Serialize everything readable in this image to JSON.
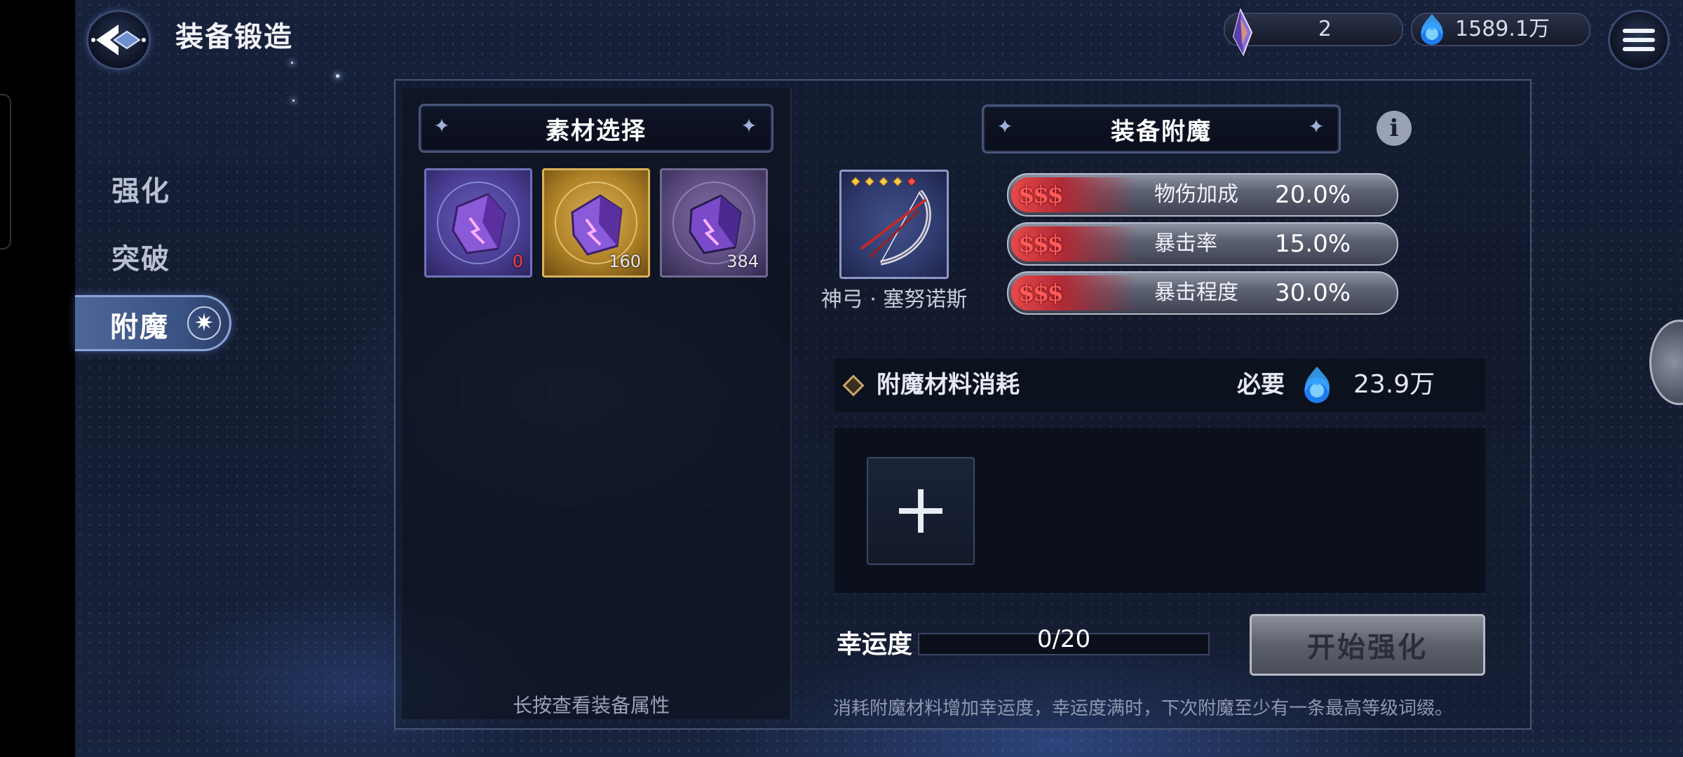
{
  "header": {
    "title": "装备锻造",
    "currency_crystal": "2",
    "currency_orb": "1589.1万"
  },
  "sidebar": {
    "items": [
      {
        "label": "强化"
      },
      {
        "label": "突破"
      },
      {
        "label": "附魔"
      }
    ],
    "active": "附魔"
  },
  "materials": {
    "title": "素材选择",
    "items": [
      {
        "rarity": "purple",
        "count": "0"
      },
      {
        "rarity": "gold",
        "count": "160"
      },
      {
        "rarity": "violet",
        "count": "384"
      }
    ],
    "hint": "长按查看装备属性"
  },
  "enchant": {
    "title": "装备附魔",
    "equipment_name": "神弓 · 塞努诺斯",
    "equipment_stars": 5,
    "stats": [
      {
        "tier": "$$$",
        "name": "物伤加成",
        "value": "20.0%"
      },
      {
        "tier": "$$$",
        "name": "暴击率",
        "value": "15.0%"
      },
      {
        "tier": "$$$",
        "name": "暴击程度",
        "value": "30.0%"
      }
    ],
    "cost_label": "附魔材料消耗",
    "cost_required_label": "必要",
    "cost_amount": "23.9万",
    "luck_label": "幸运度",
    "luck_value": "0/20",
    "luck_fraction": 0,
    "start_button": "开始强化",
    "footer_hint": "消耗附魔材料增加幸运度，幸运度满时，下次附魔至少有一条最高等级词缀。"
  },
  "colors": {
    "accent_blue": "#3a5283",
    "stat_red": "#e84848",
    "gold_frame": "#d8b35a"
  }
}
